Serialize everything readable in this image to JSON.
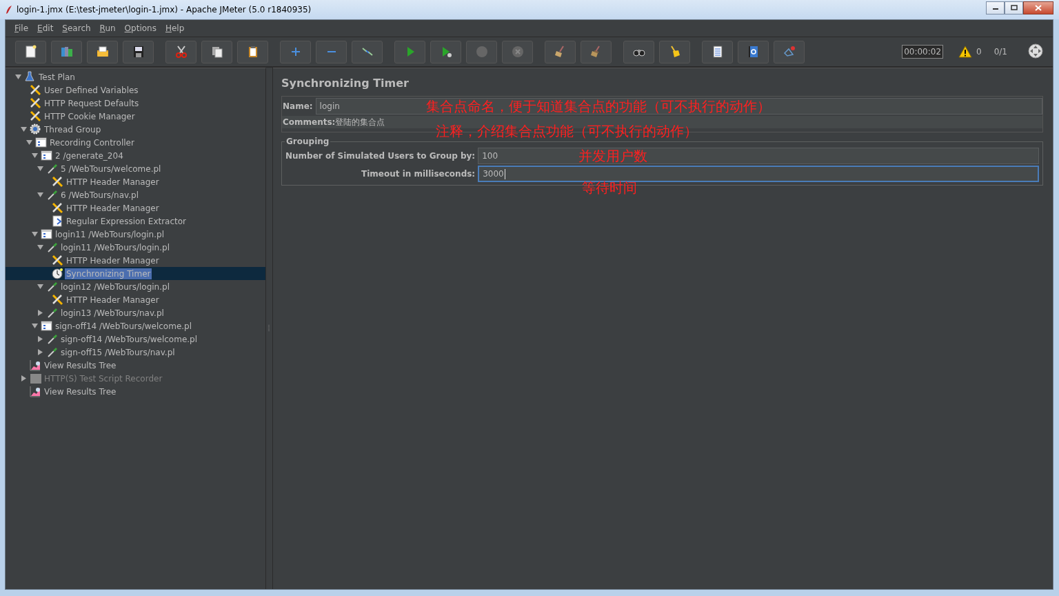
{
  "window": {
    "title": "login-1.jmx (E:\\test-jmeter\\login-1.jmx) - Apache JMeter (5.0 r1840935)"
  },
  "menu": [
    "File",
    "Edit",
    "Search",
    "Run",
    "Options",
    "Help"
  ],
  "status": {
    "timer": "00:00:02",
    "warnings": "0",
    "threads": "0/1"
  },
  "tree": [
    {
      "label": "Test Plan",
      "kind": "plan",
      "expanded": true,
      "selected": false,
      "disabled": false,
      "children": [
        {
          "label": "User Defined Variables",
          "kind": "config",
          "selected": false,
          "disabled": false
        },
        {
          "label": "HTTP Request Defaults",
          "kind": "config",
          "selected": false,
          "disabled": false
        },
        {
          "label": "HTTP Cookie Manager",
          "kind": "config",
          "selected": false,
          "disabled": false
        },
        {
          "label": "Thread Group",
          "kind": "thread",
          "expanded": true,
          "selected": false,
          "disabled": false,
          "children": [
            {
              "label": "Recording Controller",
              "kind": "controller",
              "expanded": true,
              "selected": false,
              "disabled": false,
              "children": [
                {
                  "label": "2 /generate_204",
                  "kind": "controller",
                  "expanded": true,
                  "selected": false,
                  "disabled": false,
                  "children": [
                    {
                      "label": "5 /WebTours/welcome.pl",
                      "kind": "sampler",
                      "expanded": true,
                      "selected": false,
                      "disabled": false,
                      "children": [
                        {
                          "label": "HTTP Header Manager",
                          "kind": "config",
                          "selected": false,
                          "disabled": false
                        }
                      ]
                    },
                    {
                      "label": "6 /WebTours/nav.pl",
                      "kind": "sampler",
                      "expanded": true,
                      "selected": false,
                      "disabled": false,
                      "children": [
                        {
                          "label": "HTTP Header Manager",
                          "kind": "config",
                          "selected": false,
                          "disabled": false
                        },
                        {
                          "label": "Regular Expression Extractor",
                          "kind": "extractor",
                          "selected": false,
                          "disabled": false
                        }
                      ]
                    }
                  ]
                },
                {
                  "label": "login11 /WebTours/login.pl",
                  "kind": "controller",
                  "expanded": true,
                  "selected": false,
                  "disabled": false,
                  "children": [
                    {
                      "label": "login11 /WebTours/login.pl",
                      "kind": "sampler",
                      "expanded": true,
                      "selected": false,
                      "disabled": false,
                      "children": [
                        {
                          "label": "HTTP Header Manager",
                          "kind": "config",
                          "selected": false,
                          "disabled": false
                        },
                        {
                          "label": "Synchronizing Timer",
                          "kind": "timer",
                          "selected": true,
                          "disabled": false
                        }
                      ]
                    },
                    {
                      "label": "login12 /WebTours/login.pl",
                      "kind": "sampler",
                      "expanded": true,
                      "selected": false,
                      "disabled": false,
                      "children": [
                        {
                          "label": "HTTP Header Manager",
                          "kind": "config",
                          "selected": false,
                          "disabled": false
                        }
                      ]
                    },
                    {
                      "label": "login13 /WebTours/nav.pl",
                      "kind": "sampler",
                      "expanded": false,
                      "selected": false,
                      "disabled": false
                    }
                  ]
                },
                {
                  "label": "sign-off14 /WebTours/welcome.pl",
                  "kind": "controller",
                  "expanded": true,
                  "selected": false,
                  "disabled": false,
                  "children": [
                    {
                      "label": "sign-off14 /WebTours/welcome.pl",
                      "kind": "sampler",
                      "expanded": false,
                      "selected": false,
                      "disabled": false
                    },
                    {
                      "label": "sign-off15 /WebTours/nav.pl",
                      "kind": "sampler",
                      "expanded": false,
                      "selected": false,
                      "disabled": false
                    }
                  ]
                }
              ]
            }
          ]
        },
        {
          "label": "View Results Tree",
          "kind": "listener",
          "selected": false,
          "disabled": false
        },
        {
          "label": "HTTP(S) Test Script Recorder",
          "kind": "recorder",
          "expanded": false,
          "selected": false,
          "disabled": true
        },
        {
          "label": "View Results Tree",
          "kind": "listener",
          "selected": false,
          "disabled": false
        }
      ]
    }
  ],
  "form": {
    "title": "Synchronizing Timer",
    "name": {
      "label": "Name:",
      "value": "login"
    },
    "comments": {
      "label": "Comments:",
      "value": "登陆的集合点"
    },
    "grouping": {
      "title": "Grouping",
      "fields": [
        {
          "label": "Number of Simulated Users to Group by:",
          "value": "100",
          "focused": false
        },
        {
          "label": "Timeout in milliseconds:",
          "value": "3000",
          "focused": true
        }
      ]
    }
  },
  "annotations": [
    {
      "text": "集合点命名，便于知道集合点的功能（可不执行的动作）"
    },
    {
      "text": "注释，介绍集合点功能（可不执行的动作）"
    },
    {
      "text": "并发用户数"
    },
    {
      "text": "等待时间"
    }
  ]
}
